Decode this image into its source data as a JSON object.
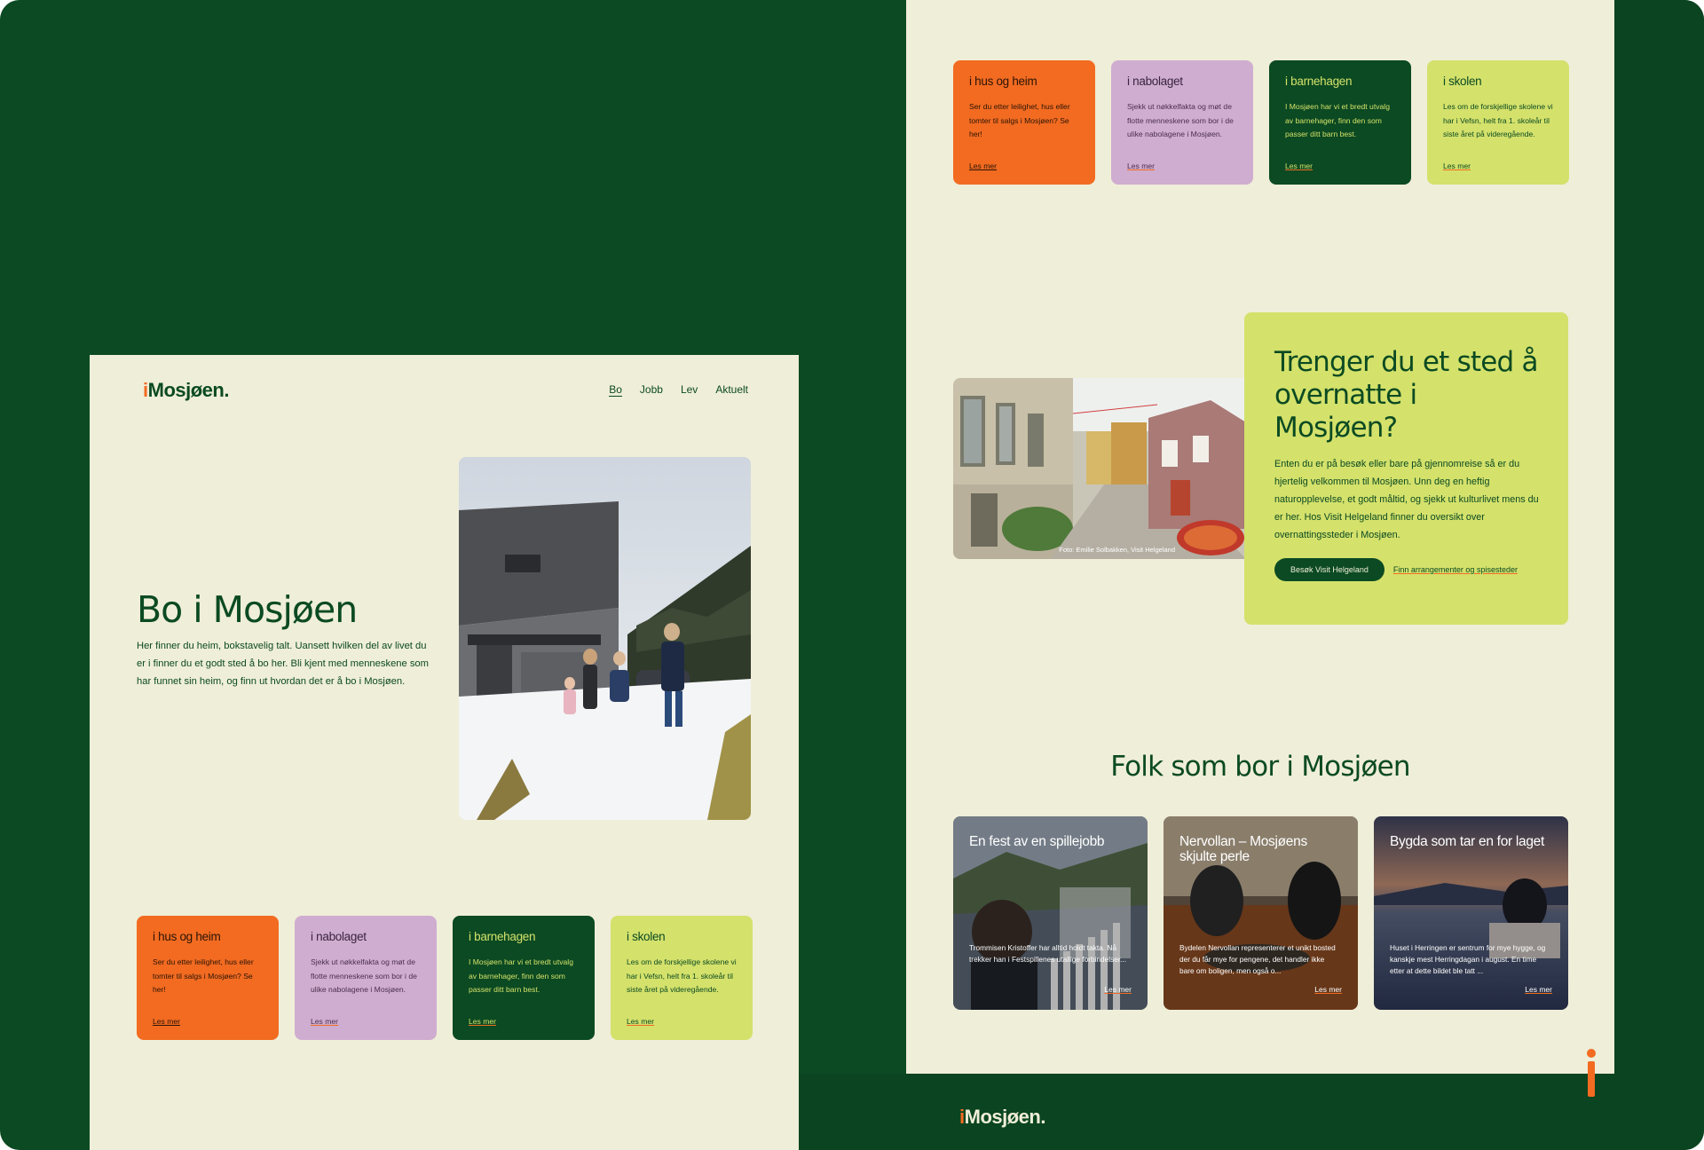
{
  "brand": {
    "i": "i",
    "name": "Mosjøen",
    "dot": "."
  },
  "nav": {
    "items": [
      "Bo",
      "Jobb",
      "Lev",
      "Aktuelt"
    ],
    "active": "Bo"
  },
  "hero": {
    "title": "Bo i Mosjøen",
    "text": "Her finner du heim, bokstavelig talt. Uansett hvilken del av livet du er i finner du et godt sted å bo her. Bli kjent med menneskene som har funnet sin heim, og finn ut hvordan det er å bo i Mosjøen."
  },
  "categories": [
    {
      "title": "i hus og heim",
      "text": "Ser du etter leilighet, hus eller tomter til salgs i Mosjøen? Se her!",
      "link": "Les mer",
      "color": "#f26b21"
    },
    {
      "title": "i nabolaget",
      "text": "Sjekk ut nøkkelfakta og møt de flotte menneskene som bor i de ulike nabolagene i Mosjøen.",
      "link": "Les mer",
      "color": "#cfadd0"
    },
    {
      "title": "i barnehagen",
      "text": "I Mosjøen har vi et bredt utvalg av barnehager, finn den som passer ditt barn best.",
      "link": "Les mer",
      "color": "#0b4a22"
    },
    {
      "title": "i skolen",
      "text": "Les om de forskjellige skolene vi har i Vefsn, helt fra 1. skoleår til siste året på videregående.",
      "link": "Les mer",
      "color": "#d4e16b"
    }
  ],
  "stay": {
    "title": "Trenger du et sted å overnatte i Mosjøen?",
    "text": "Enten du er på besøk eller bare på gjennomreise så er du hjertelig velkommen til Mosjøen. Unn deg en heftig naturopplevelse, et godt måltid, og sjekk ut kulturlivet mens du er her. Hos Visit Helgeland finner du oversikt over overnattingssteder i Mosjøen.",
    "button": "Besøk Visit Helgeland",
    "link": "Finn arrangementer og spisesteder",
    "photo_caption": "Foto: Emilie Solbakken, Visit Helgeland"
  },
  "folk": {
    "title": "Folk som bor i Mosjøen",
    "cards": [
      {
        "title": "En fest av en spillejobb",
        "text": "Trommisen Kristoffer har alltid holdt takta. Nå trekker han i Festspillenes utallige forbindelser...",
        "link": "Les mer"
      },
      {
        "title": "Nervollan – Mosjøens skjulte perle",
        "text": "Bydelen Nervollan representerer et unikt bosted der du får mye for pengene, det handler ikke bare om boligen, men også o...",
        "link": "Les mer"
      },
      {
        "title": "Bygda som tar en for laget",
        "text": "Huset i Herringen er sentrum for mye hygge, og kanskje mest Herringdagan i august. En time etter at dette bildet ble tatt ...",
        "link": "Les mer"
      }
    ]
  },
  "colors": {
    "dark_green": "#0b4a22",
    "cream": "#efeed8",
    "orange": "#f26b21",
    "lilac": "#cfadd0",
    "lime": "#d4e16b"
  }
}
